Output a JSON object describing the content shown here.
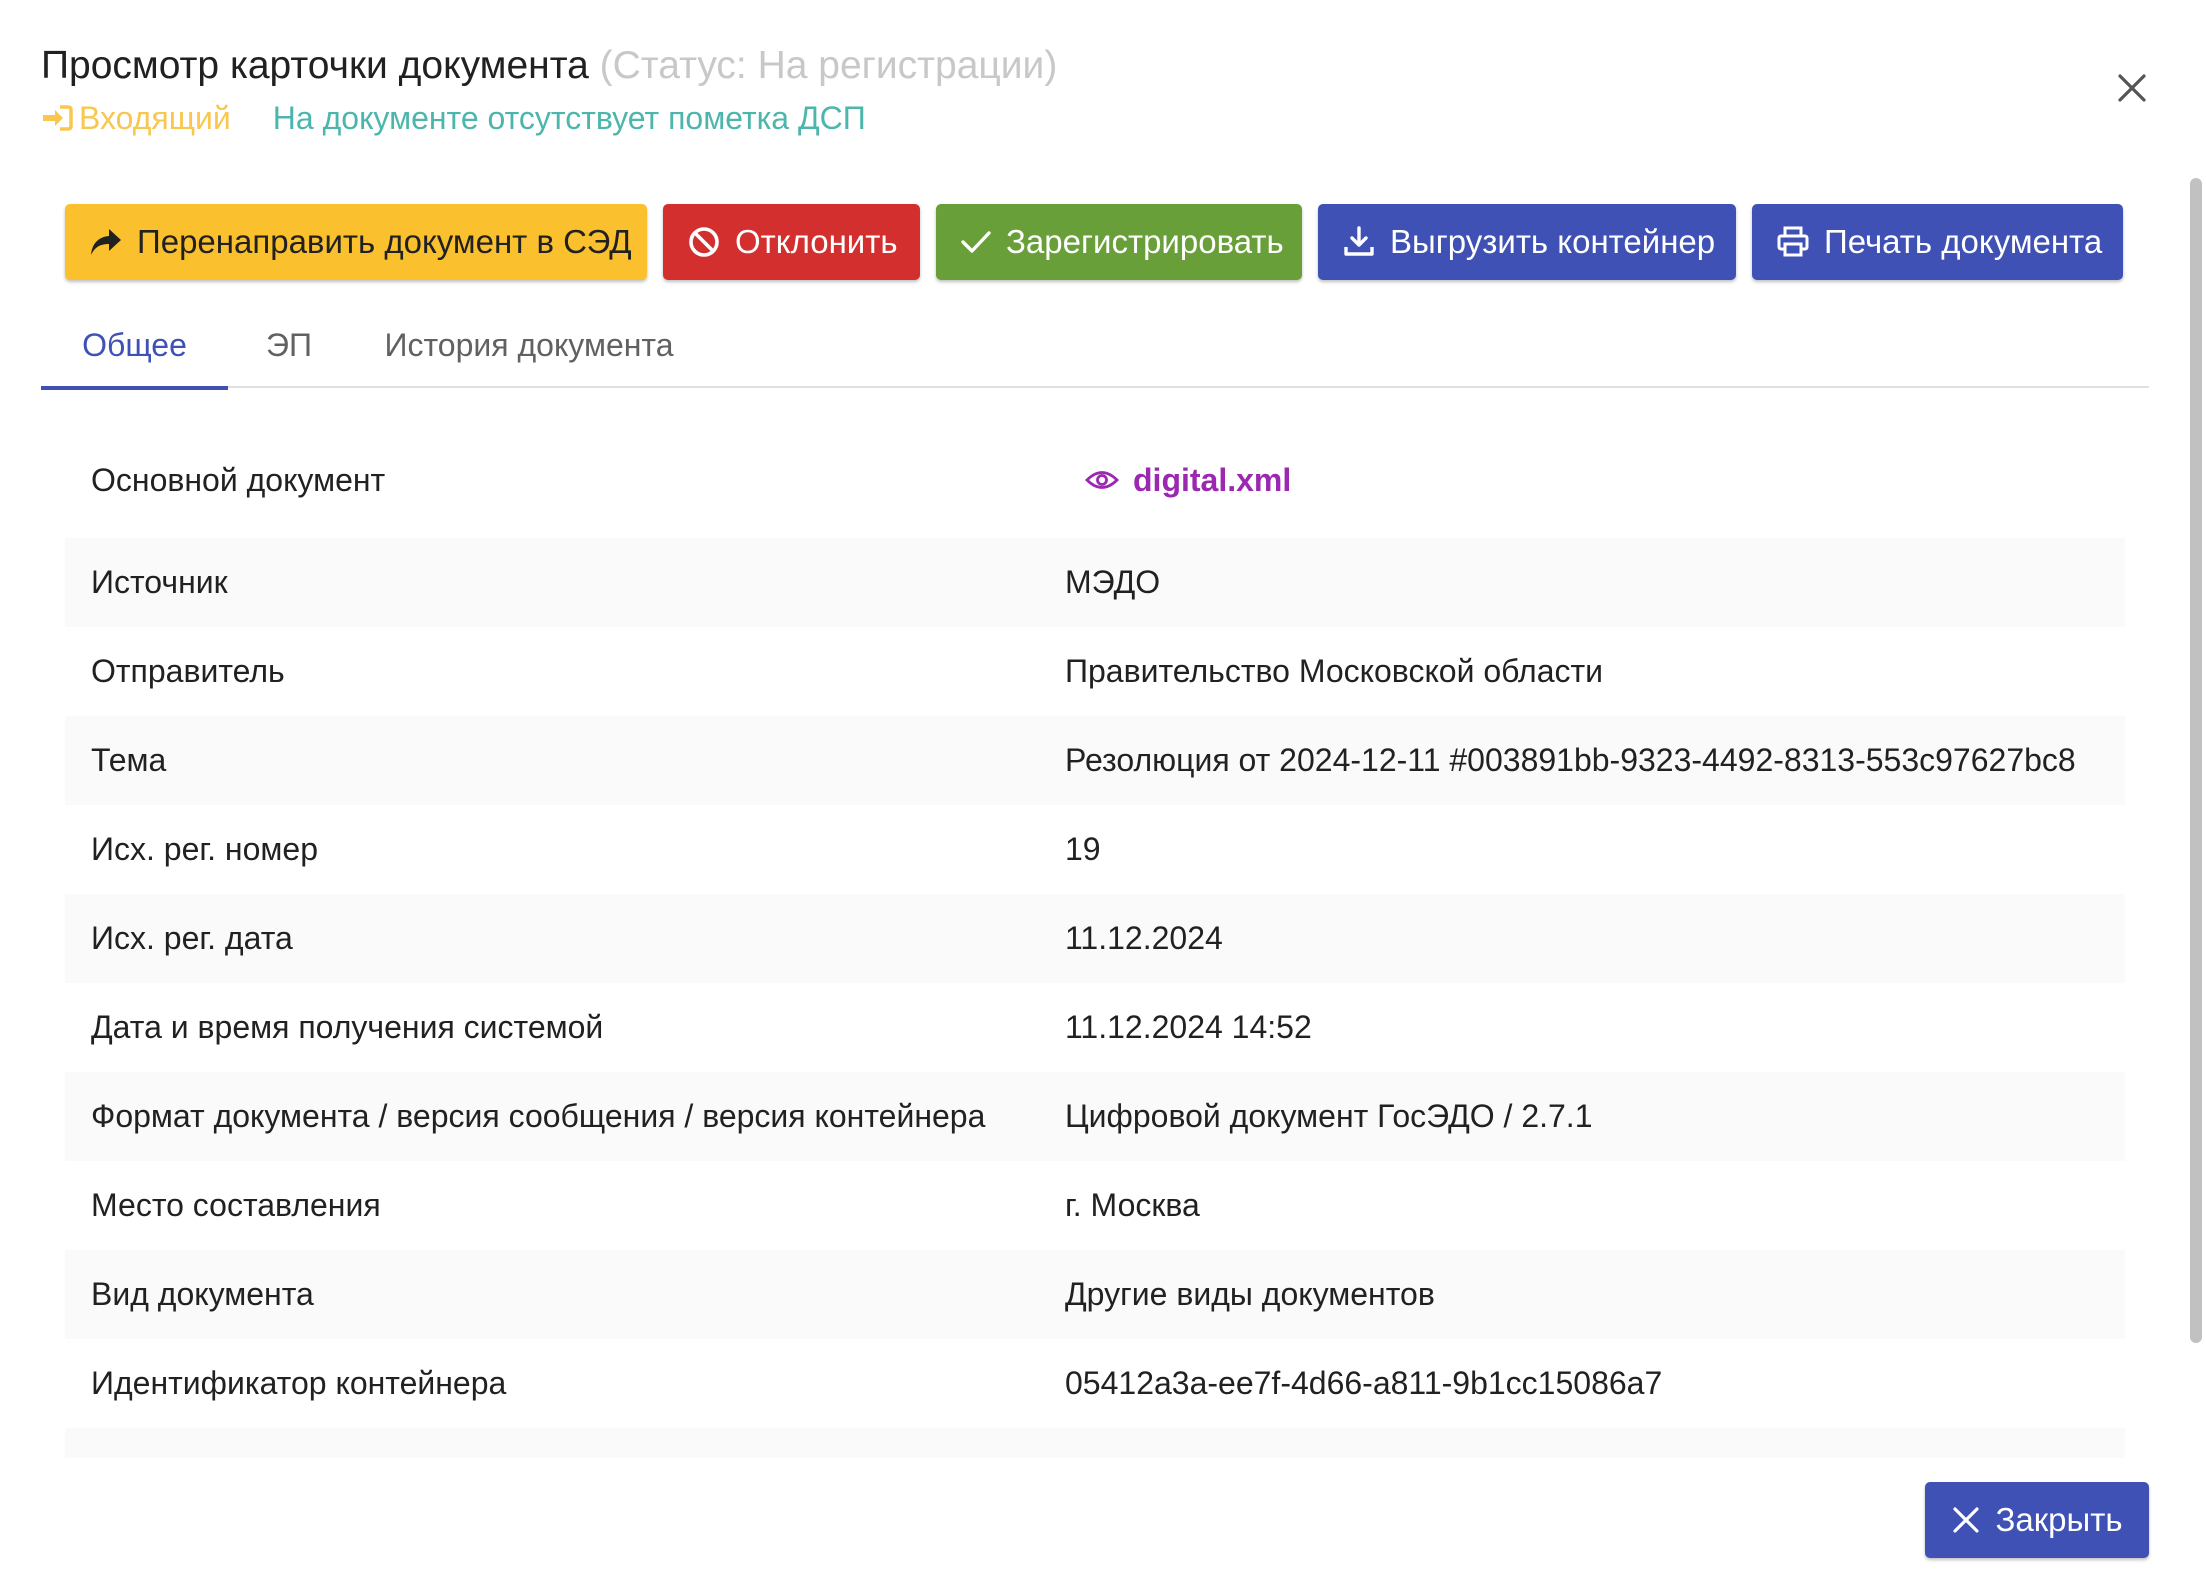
{
  "header": {
    "title": "Просмотр карточки документа",
    "status": "(Статус: На регистрации)",
    "direction": "Входящий",
    "dsp_note": "На документе отсутствует пометка ДСП",
    "colors": {
      "direction": "#f9c74f",
      "dsp_note": "#4db6ac"
    }
  },
  "actions": {
    "redirect": "Перенаправить документ в СЭД",
    "reject": "Отклонить",
    "register": "Зарегистрировать",
    "export": "Выгрузить контейнер",
    "print": "Печать документа"
  },
  "tabs": [
    {
      "label": "Общее",
      "active": true
    },
    {
      "label": "ЭП",
      "active": false
    },
    {
      "label": "История документа",
      "active": false
    }
  ],
  "details": {
    "main_document": {
      "label": "Основной документ",
      "file": "digital.xml"
    },
    "rows": [
      {
        "label": "Источник",
        "value": "МЭДО"
      },
      {
        "label": "Отправитель",
        "value": "Правительство Московской области"
      },
      {
        "label": "Тема",
        "value": "Резолюция от 2024-12-11 #003891bb-9323-4492-8313-553c97627bc8"
      },
      {
        "label": "Исх. рег. номер",
        "value": "19"
      },
      {
        "label": "Исх. рег. дата",
        "value": "11.12.2024"
      },
      {
        "label": "Дата и время получения системой",
        "value": "11.12.2024 14:52"
      },
      {
        "label": "Формат документа / версия сообщения / версия контейнера",
        "value": "Цифровой документ ГосЭДО / 2.7.1"
      },
      {
        "label": "Место составления",
        "value": "г. Москва"
      },
      {
        "label": "Вид документа",
        "value": "Другие виды документов"
      },
      {
        "label": "Идентификатор контейнера",
        "value": "05412a3a-ee7f-4d66-a811-9b1cc15086a7"
      }
    ]
  },
  "footer": {
    "close": "Закрыть"
  },
  "icons": {
    "direction": "sign-in-icon",
    "redirect": "share-arrow-icon",
    "reject": "ban-icon",
    "register": "check-icon",
    "export": "download-icon",
    "print": "print-icon",
    "file": "eye-icon",
    "close": "close-icon"
  }
}
